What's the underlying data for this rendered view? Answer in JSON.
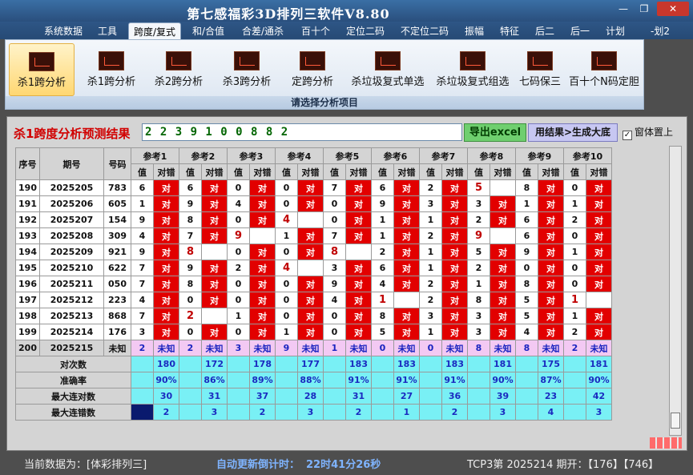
{
  "window": {
    "title": "第七感福彩3D排列三软件V8.80",
    "minimize": "—",
    "maximize": "❐",
    "close": "✕"
  },
  "menu": {
    "items": [
      "系统数据",
      "工具",
      "跨度/复式",
      "和/合值",
      "合差/通杀",
      "百十个",
      "定位二码",
      "不定位二码",
      "振幅",
      "特征",
      "后二",
      "后一",
      "计划",
      "-划2"
    ]
  },
  "ribbon": {
    "buttons": [
      "杀1跨分析",
      "杀1跨分析",
      "杀2跨分析",
      "杀3跨分析",
      "定跨分析",
      "杀垃圾复式单选",
      "杀垃圾复式组选",
      "七码保三",
      "百十个N码定胆"
    ],
    "group_label": "请选择分析项目"
  },
  "analysis": {
    "result_label": "杀1跨度分析预测结果",
    "result_value": "2 2 3 9 1 0 0 8 8 2",
    "export_button": "导出excel",
    "generate_button": "用结果>生成大底",
    "topmost_check": "✓",
    "topmost_label": "窗体置上"
  },
  "table": {
    "col_seq": "序号",
    "col_period": "期号",
    "col_code": "号码",
    "ref_headers": [
      "参考1",
      "参考2",
      "参考3",
      "参考4",
      "参考5",
      "参考6",
      "参考7",
      "参考8",
      "参考9",
      "参考10"
    ],
    "sub_value": "值",
    "sub_check": "对错",
    "rows": [
      {
        "seq": "190",
        "period": "2025205",
        "code": "783",
        "cells": [
          [
            "6",
            "对"
          ],
          [
            "6",
            "对"
          ],
          [
            "0",
            "对"
          ],
          [
            "0",
            "对"
          ],
          [
            "7",
            "对"
          ],
          [
            "6",
            "对"
          ],
          [
            "2",
            "对"
          ],
          [
            "5",
            ""
          ],
          [
            "8",
            "对"
          ],
          [
            "0",
            "对"
          ]
        ]
      },
      {
        "seq": "191",
        "period": "2025206",
        "code": "605",
        "cells": [
          [
            "1",
            "对"
          ],
          [
            "9",
            "对"
          ],
          [
            "4",
            "对"
          ],
          [
            "0",
            "对"
          ],
          [
            "0",
            "对"
          ],
          [
            "9",
            "对"
          ],
          [
            "3",
            "对"
          ],
          [
            "3",
            "对"
          ],
          [
            "1",
            "对"
          ],
          [
            "1",
            "对"
          ]
        ]
      },
      {
        "seq": "192",
        "period": "2025207",
        "code": "154",
        "cells": [
          [
            "9",
            "对"
          ],
          [
            "8",
            "对"
          ],
          [
            "0",
            "对"
          ],
          [
            "4",
            ""
          ],
          [
            "0",
            "对"
          ],
          [
            "1",
            "对"
          ],
          [
            "1",
            "对"
          ],
          [
            "2",
            "对"
          ],
          [
            "6",
            "对"
          ],
          [
            "2",
            "对"
          ]
        ]
      },
      {
        "seq": "193",
        "period": "2025208",
        "code": "309",
        "cells": [
          [
            "4",
            "对"
          ],
          [
            "7",
            "对"
          ],
          [
            "9",
            ""
          ],
          [
            "1",
            "对"
          ],
          [
            "7",
            "对"
          ],
          [
            "1",
            "对"
          ],
          [
            "2",
            "对"
          ],
          [
            "9",
            ""
          ],
          [
            "6",
            "对"
          ],
          [
            "0",
            "对"
          ]
        ]
      },
      {
        "seq": "194",
        "period": "2025209",
        "code": "921",
        "cells": [
          [
            "9",
            "对"
          ],
          [
            "8",
            ""
          ],
          [
            "0",
            "对"
          ],
          [
            "0",
            "对"
          ],
          [
            "8",
            ""
          ],
          [
            "2",
            "对"
          ],
          [
            "1",
            "对"
          ],
          [
            "5",
            "对"
          ],
          [
            "9",
            "对"
          ],
          [
            "1",
            "对"
          ]
        ]
      },
      {
        "seq": "195",
        "period": "2025210",
        "code": "622",
        "cells": [
          [
            "7",
            "对"
          ],
          [
            "9",
            "对"
          ],
          [
            "2",
            "对"
          ],
          [
            "4",
            ""
          ],
          [
            "3",
            "对"
          ],
          [
            "6",
            "对"
          ],
          [
            "1",
            "对"
          ],
          [
            "2",
            "对"
          ],
          [
            "0",
            "对"
          ],
          [
            "0",
            "对"
          ]
        ]
      },
      {
        "seq": "196",
        "period": "2025211",
        "code": "050",
        "cells": [
          [
            "7",
            "对"
          ],
          [
            "8",
            "对"
          ],
          [
            "0",
            "对"
          ],
          [
            "0",
            "对"
          ],
          [
            "9",
            "对"
          ],
          [
            "4",
            "对"
          ],
          [
            "2",
            "对"
          ],
          [
            "1",
            "对"
          ],
          [
            "8",
            "对"
          ],
          [
            "0",
            "对"
          ]
        ]
      },
      {
        "seq": "197",
        "period": "2025212",
        "code": "223",
        "cells": [
          [
            "4",
            "对"
          ],
          [
            "0",
            "对"
          ],
          [
            "0",
            "对"
          ],
          [
            "0",
            "对"
          ],
          [
            "4",
            "对"
          ],
          [
            "1",
            ""
          ],
          [
            "2",
            "对"
          ],
          [
            "8",
            "对"
          ],
          [
            "5",
            "对"
          ],
          [
            "1",
            ""
          ]
        ]
      },
      {
        "seq": "198",
        "period": "2025213",
        "code": "868",
        "cells": [
          [
            "7",
            "对"
          ],
          [
            "2",
            ""
          ],
          [
            "1",
            "对"
          ],
          [
            "0",
            "对"
          ],
          [
            "0",
            "对"
          ],
          [
            "8",
            "对"
          ],
          [
            "3",
            "对"
          ],
          [
            "3",
            "对"
          ],
          [
            "5",
            "对"
          ],
          [
            "1",
            "对"
          ]
        ]
      },
      {
        "seq": "199",
        "period": "2025214",
        "code": "176",
        "cells": [
          [
            "3",
            "对"
          ],
          [
            "0",
            "对"
          ],
          [
            "0",
            "对"
          ],
          [
            "1",
            "对"
          ],
          [
            "0",
            "对"
          ],
          [
            "5",
            "对"
          ],
          [
            "1",
            "对"
          ],
          [
            "3",
            "对"
          ],
          [
            "4",
            "对"
          ],
          [
            "2",
            "对"
          ]
        ]
      }
    ],
    "predict_row": {
      "seq": "200",
      "period": "2025215",
      "code": "未知",
      "cells": [
        [
          "2",
          "未知"
        ],
        [
          "2",
          "未知"
        ],
        [
          "3",
          "未知"
        ],
        [
          "9",
          "未知"
        ],
        [
          "1",
          "未知"
        ],
        [
          "0",
          "未知"
        ],
        [
          "0",
          "未知"
        ],
        [
          "8",
          "未知"
        ],
        [
          "8",
          "未知"
        ],
        [
          "2",
          "未知"
        ]
      ]
    },
    "stats": [
      {
        "label": "对次数",
        "values": [
          "180",
          "172",
          "178",
          "177",
          "183",
          "183",
          "183",
          "181",
          "175",
          "181"
        ]
      },
      {
        "label": "准确率",
        "values": [
          "90%",
          "86%",
          "89%",
          "88%",
          "91%",
          "91%",
          "91%",
          "90%",
          "87%",
          "90%"
        ]
      },
      {
        "label": "最大连对数",
        "values": [
          "30",
          "31",
          "37",
          "28",
          "31",
          "27",
          "36",
          "39",
          "23",
          "42"
        ]
      },
      {
        "label": "最大连错数",
        "values": [
          "2",
          "3",
          "2",
          "3",
          "2",
          "1",
          "2",
          "3",
          "4",
          "3"
        ]
      }
    ]
  },
  "status": {
    "current_data": "当前数据为：[体彩排列三]",
    "countdown_label": "自动更新倒计时：",
    "countdown_value": "22时41分26秒",
    "issue_info": "TCP3第 2025214 期开：【176】【746】"
  },
  "colors": {
    "hit": "#e20000",
    "predict": "#f3c9f3",
    "stats": "#79f0f5",
    "accent": "#1a2ac0"
  }
}
